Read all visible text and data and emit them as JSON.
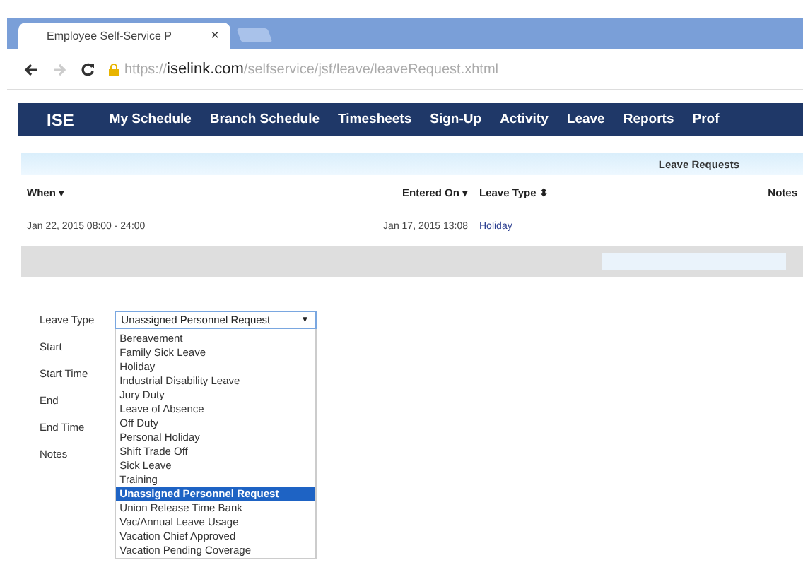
{
  "browser": {
    "tab_title": "Employee Self-Service P",
    "tab_close": "×",
    "url_scheme": "https://",
    "url_domain": "iselink.com",
    "url_path": "/selfservice/jsf/leave/leaveRequest.xhtml"
  },
  "nav": {
    "logo": "ISE",
    "items": [
      "My Schedule",
      "Branch Schedule",
      "Timesheets",
      "Sign-Up",
      "Activity",
      "Leave",
      "Reports",
      "Prof"
    ]
  },
  "table": {
    "title": "Leave Requests",
    "columns": [
      "When ▾",
      "Entered On ▾",
      "Leave Type ⬍",
      "Notes"
    ],
    "rows": [
      [
        "Jan 22, 2015 08:00 - 24:00",
        "Jan 17, 2015 13:08",
        "Holiday",
        ""
      ]
    ]
  },
  "form": {
    "labels": [
      "Leave Type",
      "Start",
      "Start Time",
      "End",
      "End Time",
      "Notes"
    ],
    "select": {
      "value": "Unassigned Personnel Request",
      "arrow": "▼",
      "expanded": true,
      "options": [
        {
          "label": "Bereavement",
          "selected": false
        },
        {
          "label": "Family Sick Leave",
          "selected": false
        },
        {
          "label": "Holiday",
          "selected": false
        },
        {
          "label": "Industrial Disability Leave",
          "selected": false
        },
        {
          "label": "Jury Duty",
          "selected": false
        },
        {
          "label": "Leave of Absence",
          "selected": false
        },
        {
          "label": "Off Duty",
          "selected": false
        },
        {
          "label": "Personal Holiday",
          "selected": false
        },
        {
          "label": "Shift Trade Off",
          "selected": false
        },
        {
          "label": "Sick Leave",
          "selected": false
        },
        {
          "label": "Training",
          "selected": false
        },
        {
          "label": "Unassigned Personnel Request",
          "selected": true
        },
        {
          "label": "Union Release Time Bank",
          "selected": false
        },
        {
          "label": "Vac/Annual Leave Usage",
          "selected": false
        },
        {
          "label": "Vacation Chief Approved",
          "selected": false
        },
        {
          "label": "Vacation Pending Coverage",
          "selected": false
        }
      ]
    }
  }
}
